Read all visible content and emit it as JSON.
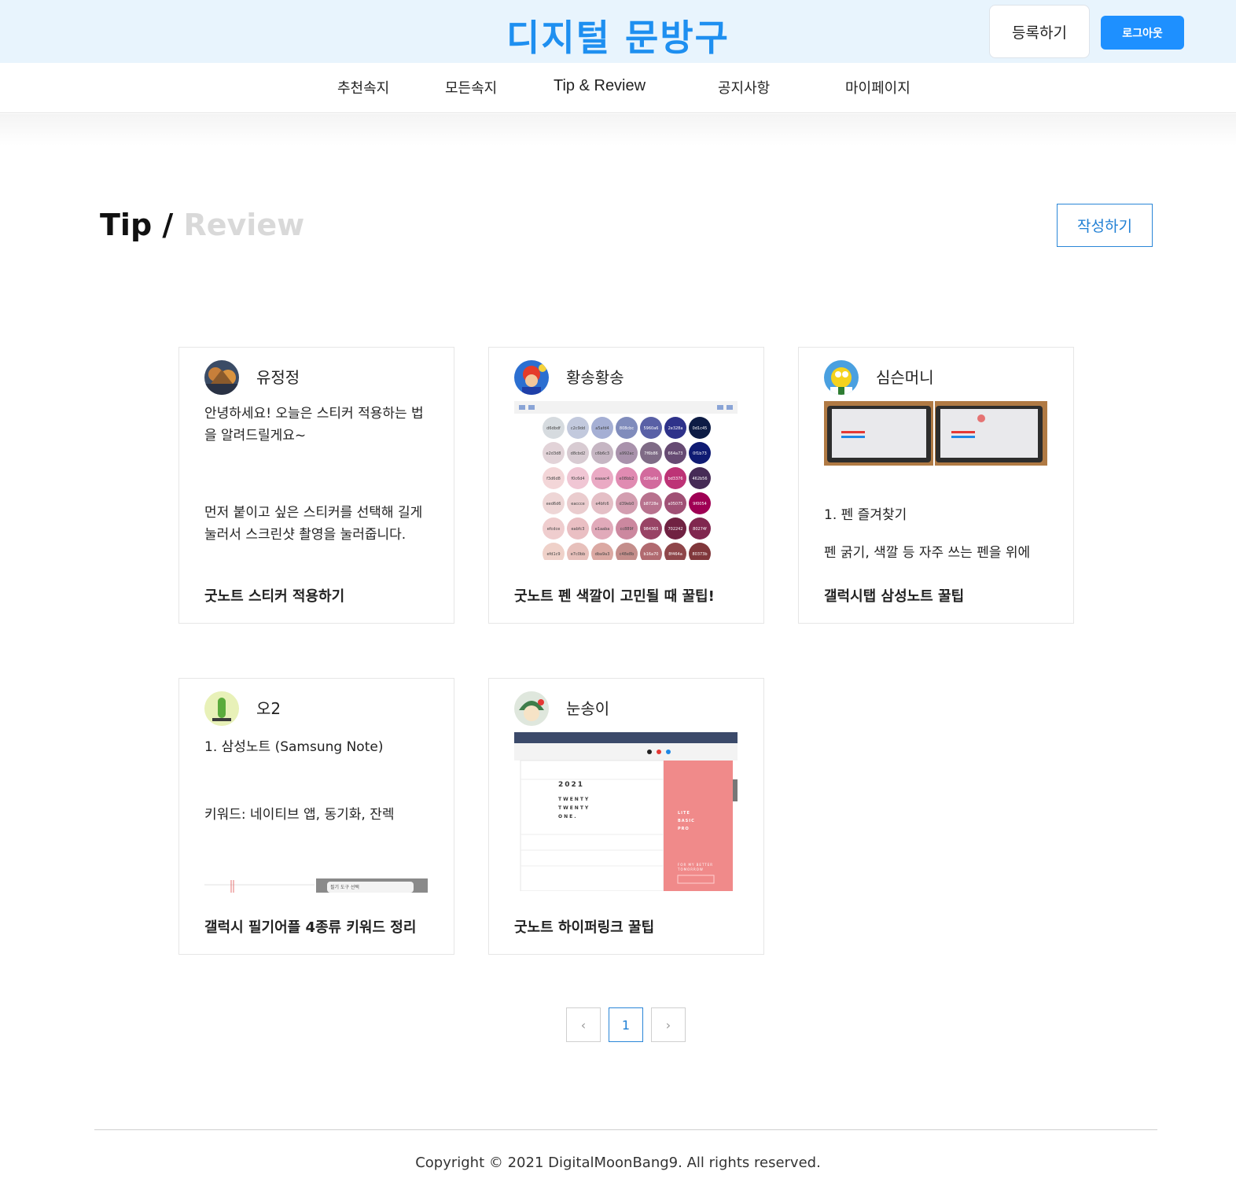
{
  "header": {
    "logo": "디지털 문방구",
    "register_label": "등록하기",
    "logout_label": "로그아웃",
    "accent_color": "#1e8ff0"
  },
  "nav": {
    "items": [
      {
        "label": "추천속지"
      },
      {
        "label": "모든속지"
      },
      {
        "label": "Tip & Review"
      },
      {
        "label": "공지사항"
      },
      {
        "label": "마이페이지"
      }
    ]
  },
  "page": {
    "title_tip": "Tip /",
    "title_review": "Review",
    "write_label": "작성하기"
  },
  "cards": [
    {
      "author": "유정정",
      "body1": "안녕하세요! 오늘은 스티커 적용하는 법을 알려드릴게요~",
      "body2": "먼저 붙이고 싶은 스티커를 선택해 길게 눌러서 스크린샷 촬영을 눌러줍니다.",
      "title": "굿노트 스티커 적용하기"
    },
    {
      "author": "황송황송",
      "title": "굿노트 펜 색깔이 고민될 때 꿀팁!",
      "swatches": [
        "d6dbdf",
        "c2c9dd",
        "a5afd4",
        "808cbc",
        "5960a6",
        "2e328a",
        "0d1c45",
        "e2d3d8",
        "d8cbd2",
        "c6b6c3",
        "a992ac",
        "7f6b86",
        "664a73",
        "0f1b73",
        "f3d6d8",
        "f0c6d4",
        "eaaac4",
        "e08bb2",
        "d26a9d",
        "bd3376",
        "462b56",
        "eed6d6",
        "eaccce",
        "e4bfc6",
        "d39eb0",
        "b8728e",
        "a05075",
        "9f0054",
        "efcdce",
        "eabfc3",
        "e1aaba",
        "cc889f",
        "984365",
        "702242",
        "80274f",
        "efd1c9",
        "e7c0bb",
        "dba9a3",
        "c48e8b",
        "b16a70",
        "8f464a",
        "80373b"
      ]
    },
    {
      "author": "심슨머니",
      "body1": "1. 펜 즐겨찾기",
      "body2": "펜 굵기, 색깔 등 자주 쓰는 펜을 위에",
      "title": "갤럭시탭 삼성노트 꿀팁"
    },
    {
      "author": "오2",
      "body1": "1. 삼성노트 (Samsung Note)",
      "body2": "키워드: 네이티브 앱, 동기화, 잔렉",
      "title": "갤럭시 필기어플 4종류 키워드 정리",
      "thumb_text": "필기 도구 선택"
    },
    {
      "author": "눈송이",
      "title": "굿노트 하이퍼링크 꿀팁",
      "thumb_year": "2021",
      "thumb_words": [
        "TWENTY",
        "TWENTY",
        "ONE."
      ],
      "thumb_side": [
        "LITE",
        "BASIC",
        "PRO"
      ],
      "thumb_footer": "FOR MY BETTER TOMORROW"
    }
  ],
  "pagination": {
    "prev": "‹",
    "current": "1",
    "next": "›"
  },
  "footer": {
    "copyright": "Copyright © 2021 DigitalMoonBang9. All rights reserved."
  }
}
